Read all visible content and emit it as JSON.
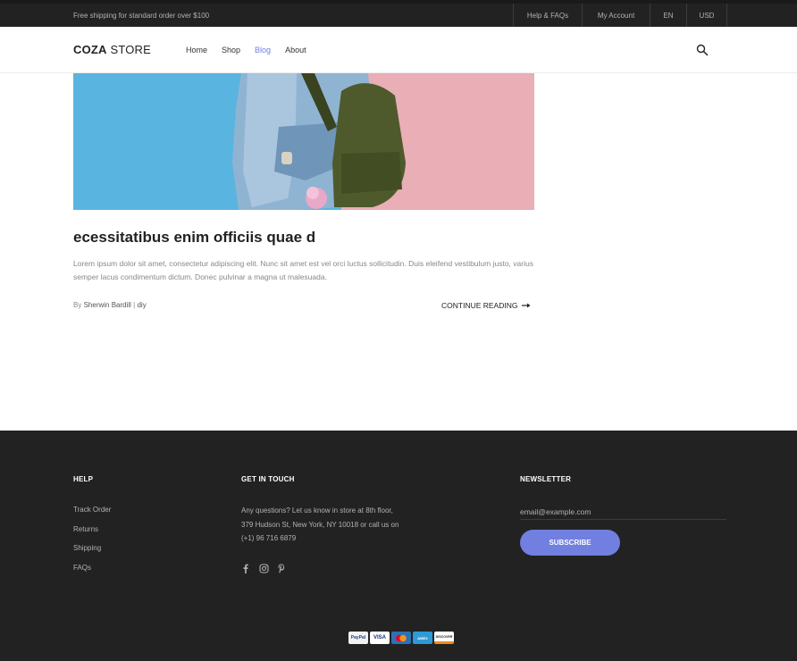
{
  "topbar": {
    "shipping": "Free shipping for standard order over $100",
    "help": "Help & FAQs",
    "account": "My Account",
    "lang": "EN",
    "currency": "USD"
  },
  "header": {
    "logo_bold": "COZA",
    "logo_rest": " STORE",
    "nav": [
      "Home",
      "Shop",
      "Blog",
      "About"
    ],
    "active_nav": "Blog",
    "accent": "#717fe0"
  },
  "post": {
    "title": "ecessitatibus enim officiis quae d",
    "excerpt": "Lorem ipsum dolor sit amet, consectetur adipiscing elit. Nunc sit amet est vel orci luctus sollicitudin. Duis eleifend vestibulum justo, varius semper lacus condimentum dictum. Donec pulvinar a magna ut malesuada.",
    "by": "By",
    "author": "Sherwin Bardill",
    "separator": "|",
    "category": "diy",
    "read_more": "CONTINUE READING"
  },
  "footer": {
    "help": {
      "heading": "HELP",
      "links": [
        "Track Order",
        "Returns",
        "Shipping",
        "FAQs"
      ]
    },
    "contact": {
      "heading": "GET IN TOUCH",
      "text": "Any questions? Let us know in store at 8th floor, 379 Hudson St, New York, NY 10018 or call us on (+1) 96 716 6879"
    },
    "newsletter": {
      "heading": "NEWSLETTER",
      "placeholder": "email@example.com",
      "button": "SUBSCRIBE"
    },
    "payments": [
      "PayPal",
      "VISA",
      "MC",
      "AMEX",
      "DISCOVER"
    ]
  }
}
